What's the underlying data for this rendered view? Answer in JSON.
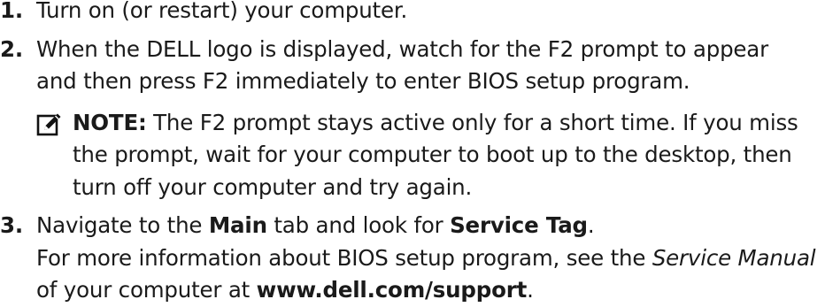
{
  "steps": [
    {
      "number": "1.",
      "lines": [
        "Turn on (or restart) your computer."
      ]
    },
    {
      "number": "2.",
      "lines": [
        "When the DELL logo is displayed, watch for the F2 prompt to appear",
        "and then press F2 immediately to enter BIOS setup program."
      ],
      "note": {
        "icon": "note-pencil-icon",
        "label": "NOTE:",
        "line1_rest": " The F2 prompt stays active only for a short time. If you miss",
        "line2": "the prompt, wait for your computer to boot up to the desktop, then",
        "line3": "turn off your computer and try again."
      }
    },
    {
      "number": "3.",
      "line1": {
        "t1": "Navigate to the ",
        "b1": "Main",
        "t2": " tab and look for ",
        "b2": "Service Tag",
        "t3": "."
      },
      "line2": {
        "t1": "For more information about BIOS setup program, see the ",
        "i1": "Service Manual"
      },
      "line3": {
        "t1": "of your computer at ",
        "link": "www.dell.com/support",
        "t2": "."
      }
    }
  ]
}
